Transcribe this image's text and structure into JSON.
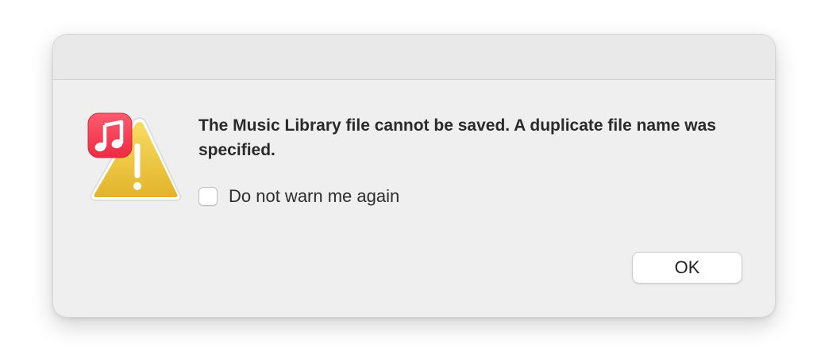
{
  "dialog": {
    "message": "The Music Library file cannot be saved. A duplicate file name was specified.",
    "checkbox": {
      "label": "Do not warn me again",
      "checked": false
    },
    "ok_button_label": "OK"
  },
  "icons": {
    "warning": "warning-triangle-icon",
    "app_badge": "music-app-icon"
  },
  "colors": {
    "dialog_background": "#efefef",
    "warning_yellow": "#f0c93a",
    "music_badge_red": "#f43f52"
  }
}
